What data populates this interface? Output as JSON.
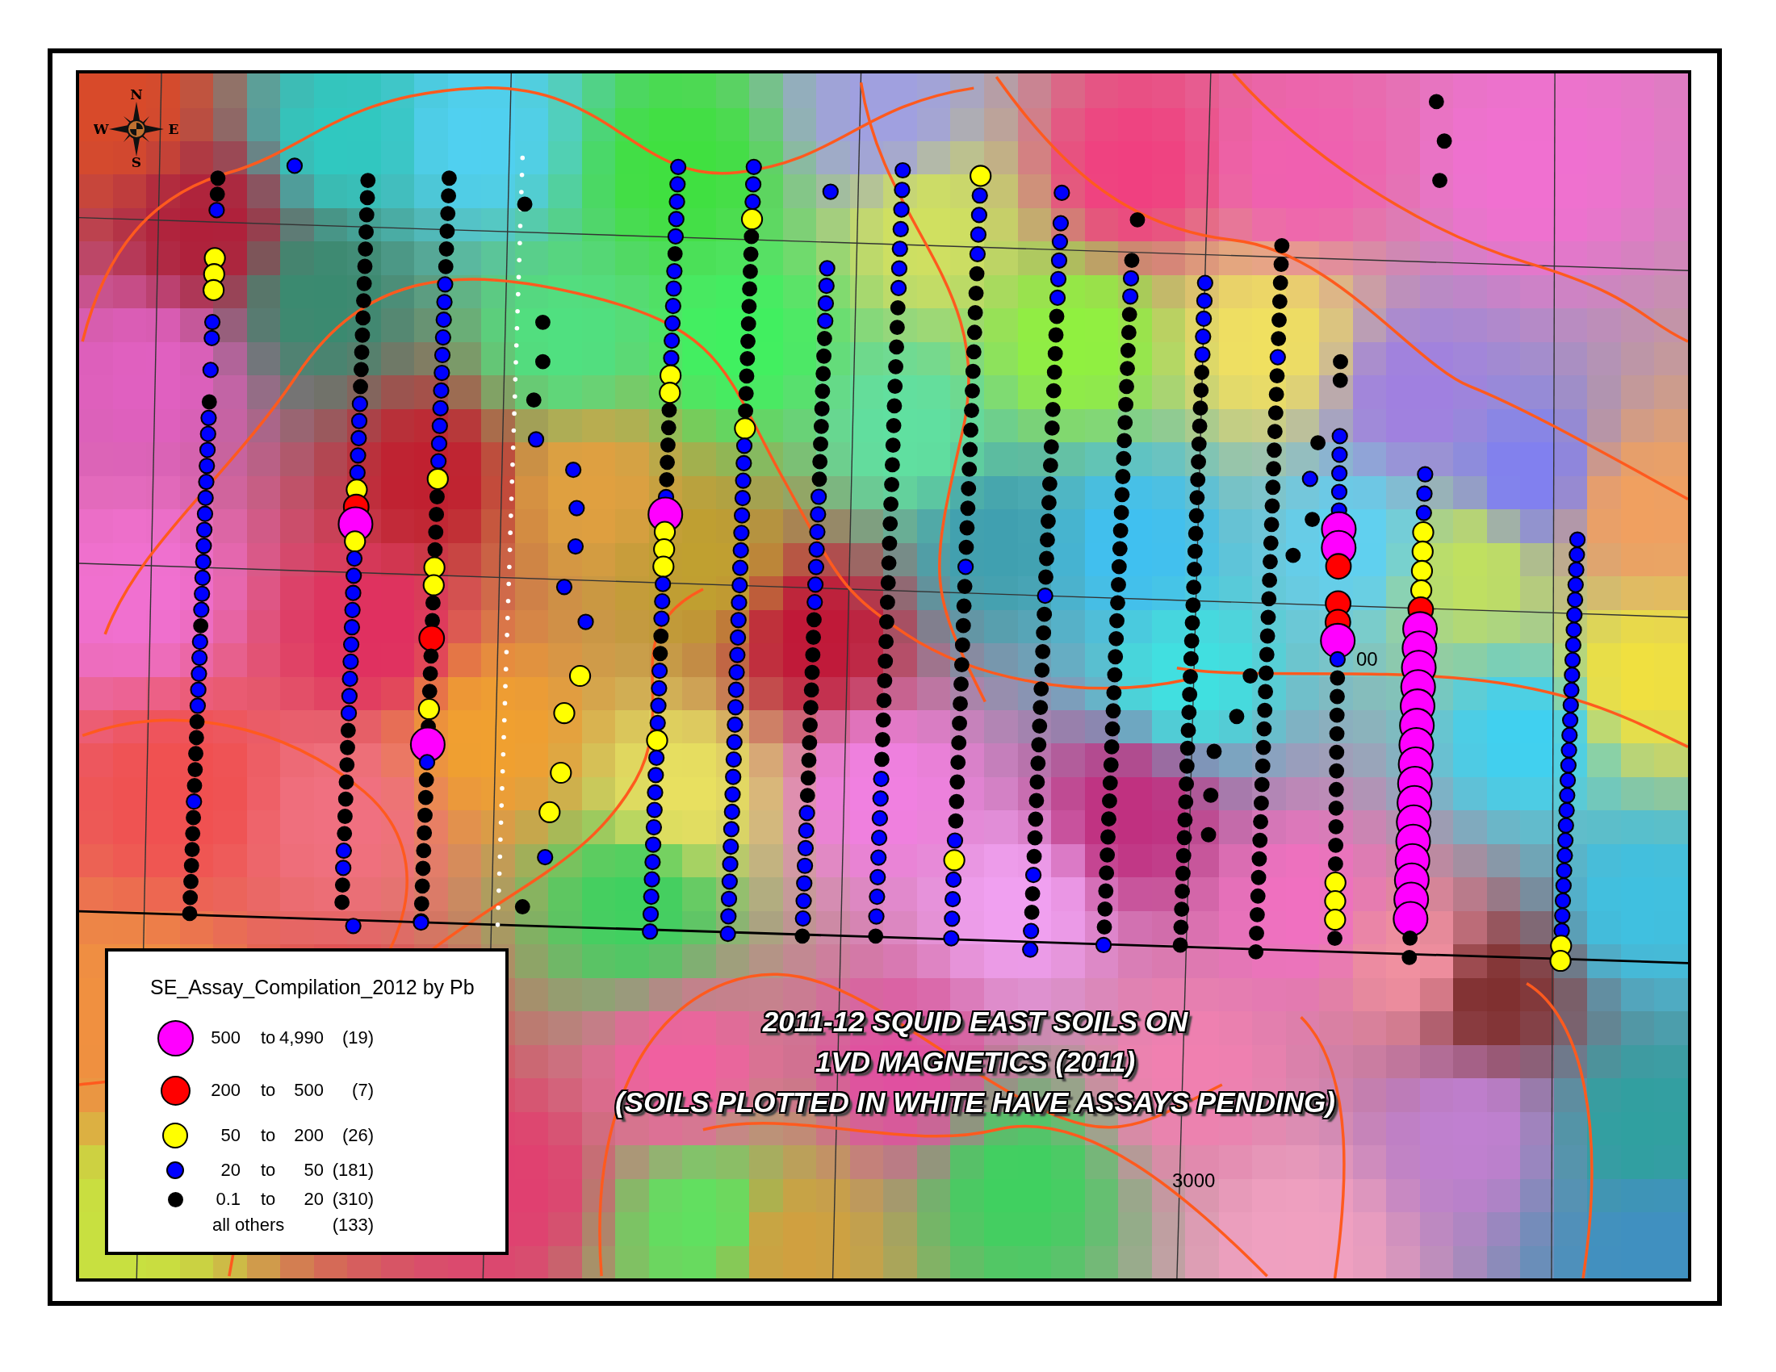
{
  "map": {
    "compass": {
      "north": "N",
      "east": "E",
      "south": "S",
      "west": "W"
    },
    "grid_labels": [
      "00",
      "3000"
    ]
  },
  "title": {
    "lines": [
      "2011-12 SQUID EAST SOILS ON",
      "1VD MAGNETICS (2011)",
      "(SOILS PLOTTED IN WHITE HAVE ASSAYS PENDING)"
    ]
  },
  "legend": {
    "title": "SE_Assay_Compilation_2012 by Pb",
    "classes": [
      {
        "kind": "range",
        "low": "500",
        "to": "to",
        "high": "4,990",
        "count": "(19)",
        "color": "#ff00ff"
      },
      {
        "kind": "range",
        "low": "200",
        "to": "to",
        "high": "500",
        "count": "(7)",
        "color": "#ff0000"
      },
      {
        "kind": "range",
        "low": "50",
        "to": "to",
        "high": "200",
        "count": "(26)",
        "color": "#ffff00"
      },
      {
        "kind": "range",
        "low": "20",
        "to": "to",
        "high": "50",
        "count": "(181)",
        "color": "#0000ff"
      },
      {
        "kind": "range",
        "low": "0.1",
        "to": "to",
        "high": "20",
        "count": "(310)",
        "color": "#000000"
      },
      {
        "kind": "other",
        "label": "all others",
        "count": "(133)"
      }
    ]
  }
}
